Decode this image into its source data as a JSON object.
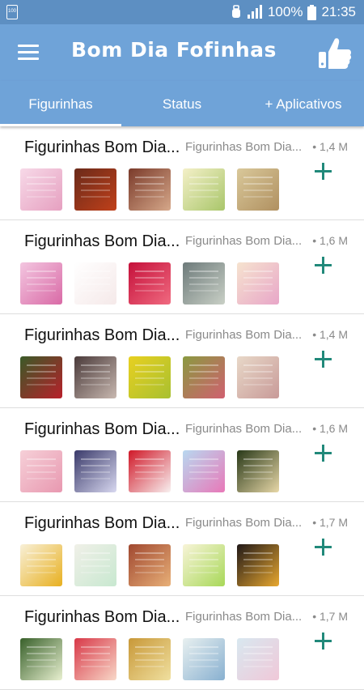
{
  "status_bar": {
    "notification_badge": "100",
    "battery_percent": "100%",
    "time": "21:35",
    "icons": [
      "notification-icon",
      "alarm-icon",
      "signal-icon",
      "battery-icon"
    ]
  },
  "app_bar": {
    "title": "Bom Dia Fofinhas",
    "menu_icon": "menu-icon",
    "action_icon": "thumbs-up-icon",
    "color": "#6fa3d8"
  },
  "tabs": [
    {
      "label": "Figurinhas",
      "selected": true
    },
    {
      "label": "Status",
      "selected": false
    },
    {
      "label": "+ Aplicativos",
      "selected": false
    }
  ],
  "packs": [
    {
      "name": "Figurinhas Bom Dia...",
      "author": "Figurinhas Bom Dia...",
      "size": "• 1,4 M",
      "stickers": [
        [
          "#f7d9e8",
          "#e6a0c0"
        ],
        [
          "#6a2a1a",
          "#c0401a"
        ],
        [
          "#7a3a2a",
          "#d6a88a"
        ],
        [
          "#f4f0c8",
          "#a9c66a"
        ],
        [
          "#d9c89a",
          "#b09060"
        ]
      ]
    },
    {
      "name": "Figurinhas Bom Dia...",
      "author": "Figurinhas Bom Dia...",
      "size": "• 1,6 M",
      "stickers": [
        [
          "#f3c6e0",
          "#d96aa6"
        ],
        [
          "#ffffff",
          "#f5e9e9"
        ],
        [
          "#c5103a",
          "#f06a80"
        ],
        [
          "#6d7a7a",
          "#c9d0c6"
        ],
        [
          "#f6e3cf",
          "#e8a6c8"
        ]
      ]
    },
    {
      "name": "Figurinhas Bom Dia...",
      "author": "Figurinhas Bom Dia...",
      "size": "• 1,4 M",
      "stickers": [
        [
          "#3a5a28",
          "#b8202a"
        ],
        [
          "#4a3a3a",
          "#c8b8b0"
        ],
        [
          "#e8d020",
          "#a8c030"
        ],
        [
          "#8a9a40",
          "#d06070"
        ],
        [
          "#e8d8c8",
          "#c89a98"
        ]
      ]
    },
    {
      "name": "Figurinhas Bom Dia...",
      "author": "Figurinhas Bom Dia...",
      "size": "• 1,6 M",
      "stickers": [
        [
          "#f6d0d8",
          "#e898b0"
        ],
        [
          "#3a3a6a",
          "#d8d8f0"
        ],
        [
          "#d01828",
          "#f8f0f0"
        ],
        [
          "#b8d8f0",
          "#e878b8"
        ],
        [
          "#283818",
          "#e8d8a8"
        ]
      ]
    },
    {
      "name": "Figurinhas Bom Dia...",
      "author": "Figurinhas Bom Dia...",
      "size": "• 1,7 M",
      "stickers": [
        [
          "#f8f0d8",
          "#e8b020"
        ],
        [
          "#f0f0e8",
          "#c8e8d0"
        ],
        [
          "#a04830",
          "#e8b078"
        ],
        [
          "#f8f4d8",
          "#a8d858"
        ],
        [
          "#201818",
          "#e8a830"
        ]
      ]
    },
    {
      "name": "Figurinhas Bom Dia...",
      "author": "Figurinhas Bom Dia...",
      "size": "• 1,7 M",
      "stickers": [
        [
          "#38602a",
          "#e8f0d0"
        ],
        [
          "#d83848",
          "#f8d8c8"
        ],
        [
          "#c89838",
          "#f0e0a0"
        ],
        [
          "#e8f0f0",
          "#88b0d0"
        ],
        [
          "#d8e8f0",
          "#f0c8d8"
        ]
      ]
    }
  ]
}
